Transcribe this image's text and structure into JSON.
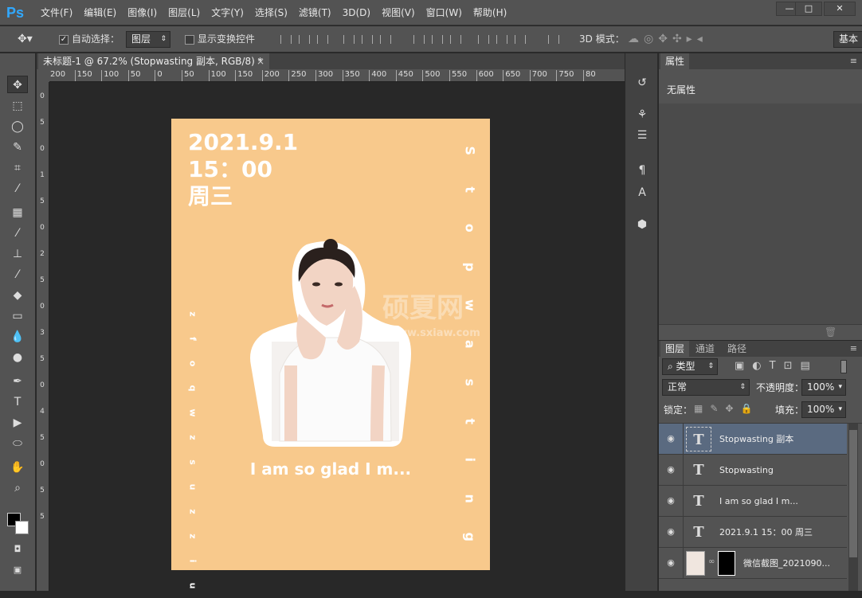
{
  "app": {
    "logo": "Ps"
  },
  "menu": [
    "文件(F)",
    "编辑(E)",
    "图像(I)",
    "图层(L)",
    "文字(Y)",
    "选择(S)",
    "滤镜(T)",
    "3D(D)",
    "视图(V)",
    "窗口(W)",
    "帮助(H)"
  ],
  "window_controls": {
    "minimize": "—",
    "maximize": "□",
    "close": "✕"
  },
  "options": {
    "auto_select_label": "自动选择：",
    "auto_select_checked": true,
    "auto_select_target": "图层",
    "show_transform_label": "显示变换控件",
    "show_transform_checked": false,
    "mode_3d_label": "3D 模式：",
    "workspace": "基本"
  },
  "document": {
    "tab_title": "未标题-1 @ 67.2% (Stopwasting  副本, RGB/8) *",
    "tab_close": "×",
    "ruler_h": [
      "200",
      "150",
      "100",
      "50",
      "0",
      "50",
      "100",
      "150",
      "200",
      "250",
      "300",
      "350",
      "400",
      "450",
      "500",
      "550",
      "600",
      "650",
      "700",
      "750",
      "80"
    ],
    "ruler_v": [
      "0",
      "5",
      "0",
      "1",
      "5",
      "0",
      "2",
      "5",
      "0",
      "3",
      "5",
      "0",
      "4",
      "5",
      "0",
      "5",
      "5"
    ]
  },
  "poster": {
    "date_line1": "2021.9.1",
    "date_line2": "15：00",
    "date_line3": "周三",
    "vertical_right": [
      "S",
      "t",
      "o",
      "p",
      "w",
      "a",
      "s",
      "t",
      "i",
      "n",
      "g"
    ],
    "vertical_left": [
      "z",
      "f",
      "o",
      "q",
      "w",
      "z",
      "s",
      "u",
      "z",
      "z",
      "i",
      "u"
    ],
    "tagline": "I am so glad I m...",
    "watermark": "硕夏网",
    "watermark_url": "www.sxiaw.com",
    "bg_color": "#f8c98c"
  },
  "properties": {
    "tab": "属性",
    "content": "无属性"
  },
  "layers_panel": {
    "tabs": [
      "图层",
      "通道",
      "路径"
    ],
    "filter_kind": "类型",
    "blend_mode": "正常",
    "opacity_label": "不透明度：",
    "opacity": "100%",
    "lock_label": "锁定：",
    "fill_label": "填充：",
    "fill": "100%",
    "layers": [
      {
        "name": "Stopwasting  副本",
        "type": "text",
        "selected": true
      },
      {
        "name": "Stopwasting",
        "type": "text",
        "selected": false
      },
      {
        "name": " I am so glad I m...",
        "type": "text",
        "selected": false
      },
      {
        "name": "2021.9.1  15：00 周三",
        "type": "text",
        "selected": false
      },
      {
        "name": "微信截图_2021090...",
        "type": "image",
        "selected": false
      }
    ]
  }
}
